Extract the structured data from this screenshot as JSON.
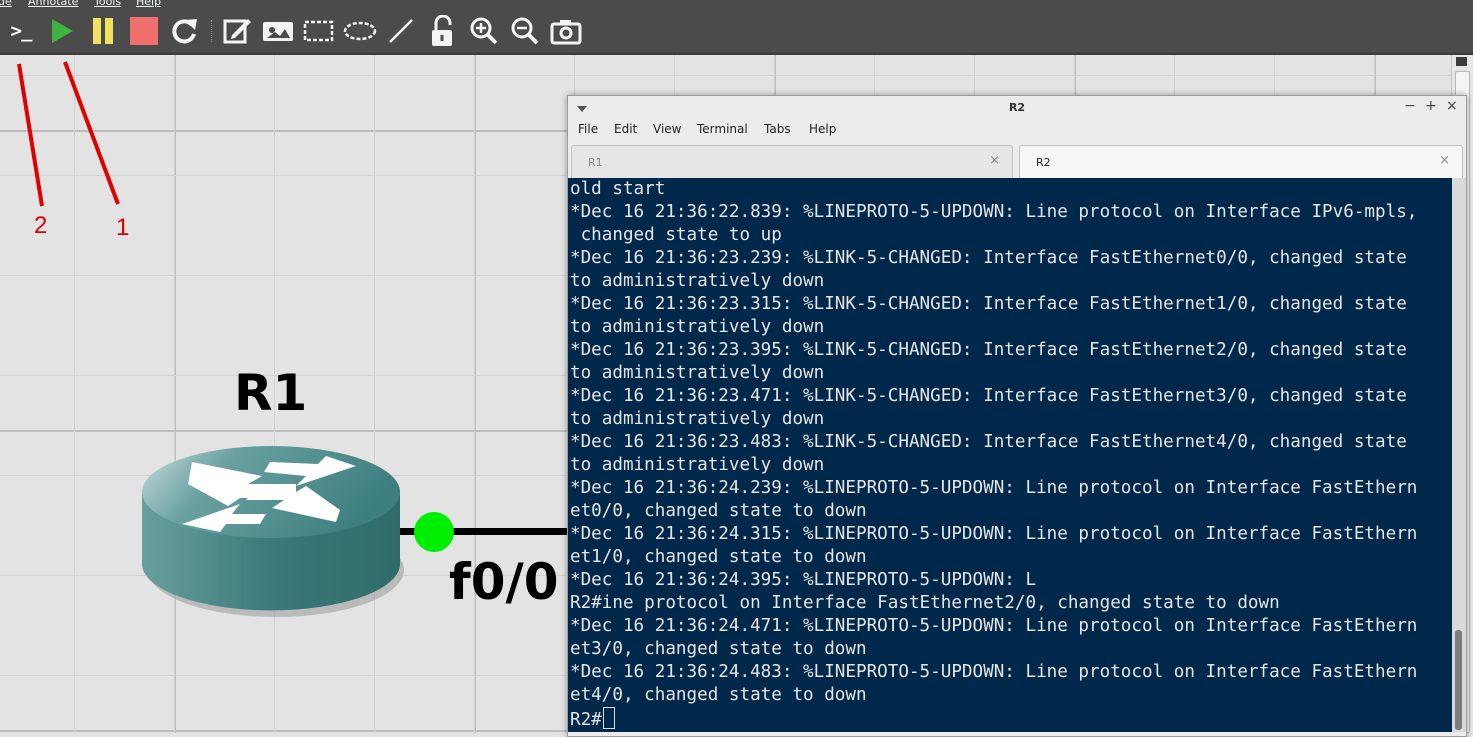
{
  "menubar": {
    "items": [
      "de",
      "Annotate",
      "Tools",
      "Help"
    ]
  },
  "toolbar": {
    "buttons": [
      {
        "name": "console-icon",
        "label": ">_"
      },
      {
        "name": "start-icon"
      },
      {
        "name": "suspend-icon"
      },
      {
        "name": "stop-icon"
      },
      {
        "name": "reload-icon"
      },
      {
        "name": "add-note-icon"
      },
      {
        "name": "insert-picture-icon"
      },
      {
        "name": "draw-rectangle-icon"
      },
      {
        "name": "draw-ellipse-icon"
      },
      {
        "name": "draw-line-icon"
      },
      {
        "name": "lock-icon"
      },
      {
        "name": "zoom-in-icon"
      },
      {
        "name": "zoom-out-icon"
      },
      {
        "name": "screenshot-icon"
      }
    ],
    "colors": {
      "start": "#3fb33f",
      "pause": "#f2e060",
      "stop": "#f07070"
    }
  },
  "annotations": {
    "label_1": "1",
    "label_2": "2",
    "color": "#e00000"
  },
  "topology": {
    "router_name": "R1",
    "port_label": "f0/0",
    "link_status_color": "#00ee00"
  },
  "terminal": {
    "title": "R2",
    "menu": [
      "File",
      "Edit",
      "View",
      "Terminal",
      "Tabs",
      "Help"
    ],
    "tabs": [
      {
        "label": "R1",
        "active": false
      },
      {
        "label": "R2",
        "active": true
      }
    ],
    "close_glyph": "×",
    "background": "#00284a",
    "lines": [
      "old start",
      "*Dec 16 21:36:22.839: %LINEPROTO-5-UPDOWN: Line protocol on Interface IPv6-mpls,",
      " changed state to up",
      "*Dec 16 21:36:23.239: %LINK-5-CHANGED: Interface FastEthernet0/0, changed state",
      "to administratively down",
      "*Dec 16 21:36:23.315: %LINK-5-CHANGED: Interface FastEthernet1/0, changed state",
      "to administratively down",
      "*Dec 16 21:36:23.395: %LINK-5-CHANGED: Interface FastEthernet2/0, changed state",
      "to administratively down",
      "*Dec 16 21:36:23.471: %LINK-5-CHANGED: Interface FastEthernet3/0, changed state",
      "to administratively down",
      "*Dec 16 21:36:23.483: %LINK-5-CHANGED: Interface FastEthernet4/0, changed state",
      "to administratively down",
      "*Dec 16 21:36:24.239: %LINEPROTO-5-UPDOWN: Line protocol on Interface FastEthern",
      "et0/0, changed state to down",
      "*Dec 16 21:36:24.315: %LINEPROTO-5-UPDOWN: Line protocol on Interface FastEthern",
      "et1/0, changed state to down",
      "*Dec 16 21:36:24.395: %LINEPROTO-5-UPDOWN: L",
      "R2#ine protocol on Interface FastEthernet2/0, changed state to down",
      "*Dec 16 21:36:24.471: %LINEPROTO-5-UPDOWN: Line protocol on Interface FastEthern",
      "et3/0, changed state to down",
      "*Dec 16 21:36:24.483: %LINEPROTO-5-UPDOWN: Line protocol on Interface FastEthern",
      "et4/0, changed state to down"
    ],
    "prompt": "R2#"
  }
}
